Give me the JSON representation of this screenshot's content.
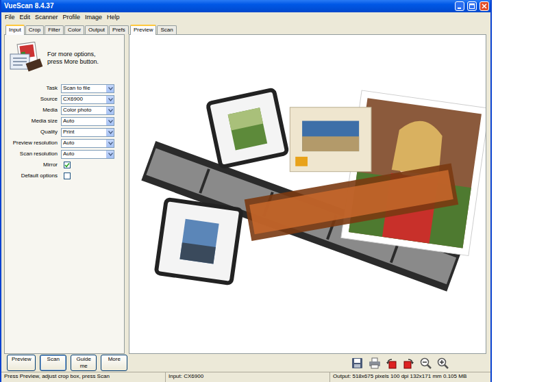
{
  "window": {
    "title": "VueScan 8.4.37"
  },
  "menu": [
    "File",
    "Edit",
    "Scanner",
    "Profile",
    "Image",
    "Help"
  ],
  "settings_tabs": [
    {
      "label": "Input",
      "selected": true
    },
    {
      "label": "Crop",
      "selected": false
    },
    {
      "label": "Filter",
      "selected": false
    },
    {
      "label": "Color",
      "selected": false
    },
    {
      "label": "Output",
      "selected": false
    },
    {
      "label": "Prefs",
      "selected": false
    }
  ],
  "hint": [
    "For more options,",
    "press More button."
  ],
  "fields": [
    {
      "label": "Task",
      "kind": "select",
      "value": "Scan to file"
    },
    {
      "label": "Source",
      "kind": "select",
      "value": "CX6900"
    },
    {
      "label": "Media",
      "kind": "select",
      "value": "Color photo"
    },
    {
      "label": "Media size",
      "kind": "select",
      "value": "Auto"
    },
    {
      "label": "Quality",
      "kind": "select",
      "value": "Print"
    },
    {
      "label": "Preview resolution",
      "kind": "select",
      "value": "Auto"
    },
    {
      "label": "Scan resolution",
      "kind": "select",
      "value": "Auto"
    },
    {
      "label": "Mirror",
      "kind": "checkbox",
      "checked": true
    },
    {
      "label": "Default options",
      "kind": "checkbox",
      "checked": false
    }
  ],
  "view_tabs": [
    {
      "label": "Preview",
      "selected": true
    },
    {
      "label": "Scan",
      "selected": false
    }
  ],
  "buttons": [
    {
      "label": "Preview",
      "focused": false
    },
    {
      "label": "Scan",
      "focused": true
    },
    {
      "label": "Guide me",
      "focused": false
    },
    {
      "label": "More",
      "focused": false
    }
  ],
  "status_bar": [
    "Press Preview, adjust crop box, press Scan",
    "Input: CX6900",
    "Output: 518x675 pixels 100 dpi 132x171 mm 0.105 MB"
  ]
}
